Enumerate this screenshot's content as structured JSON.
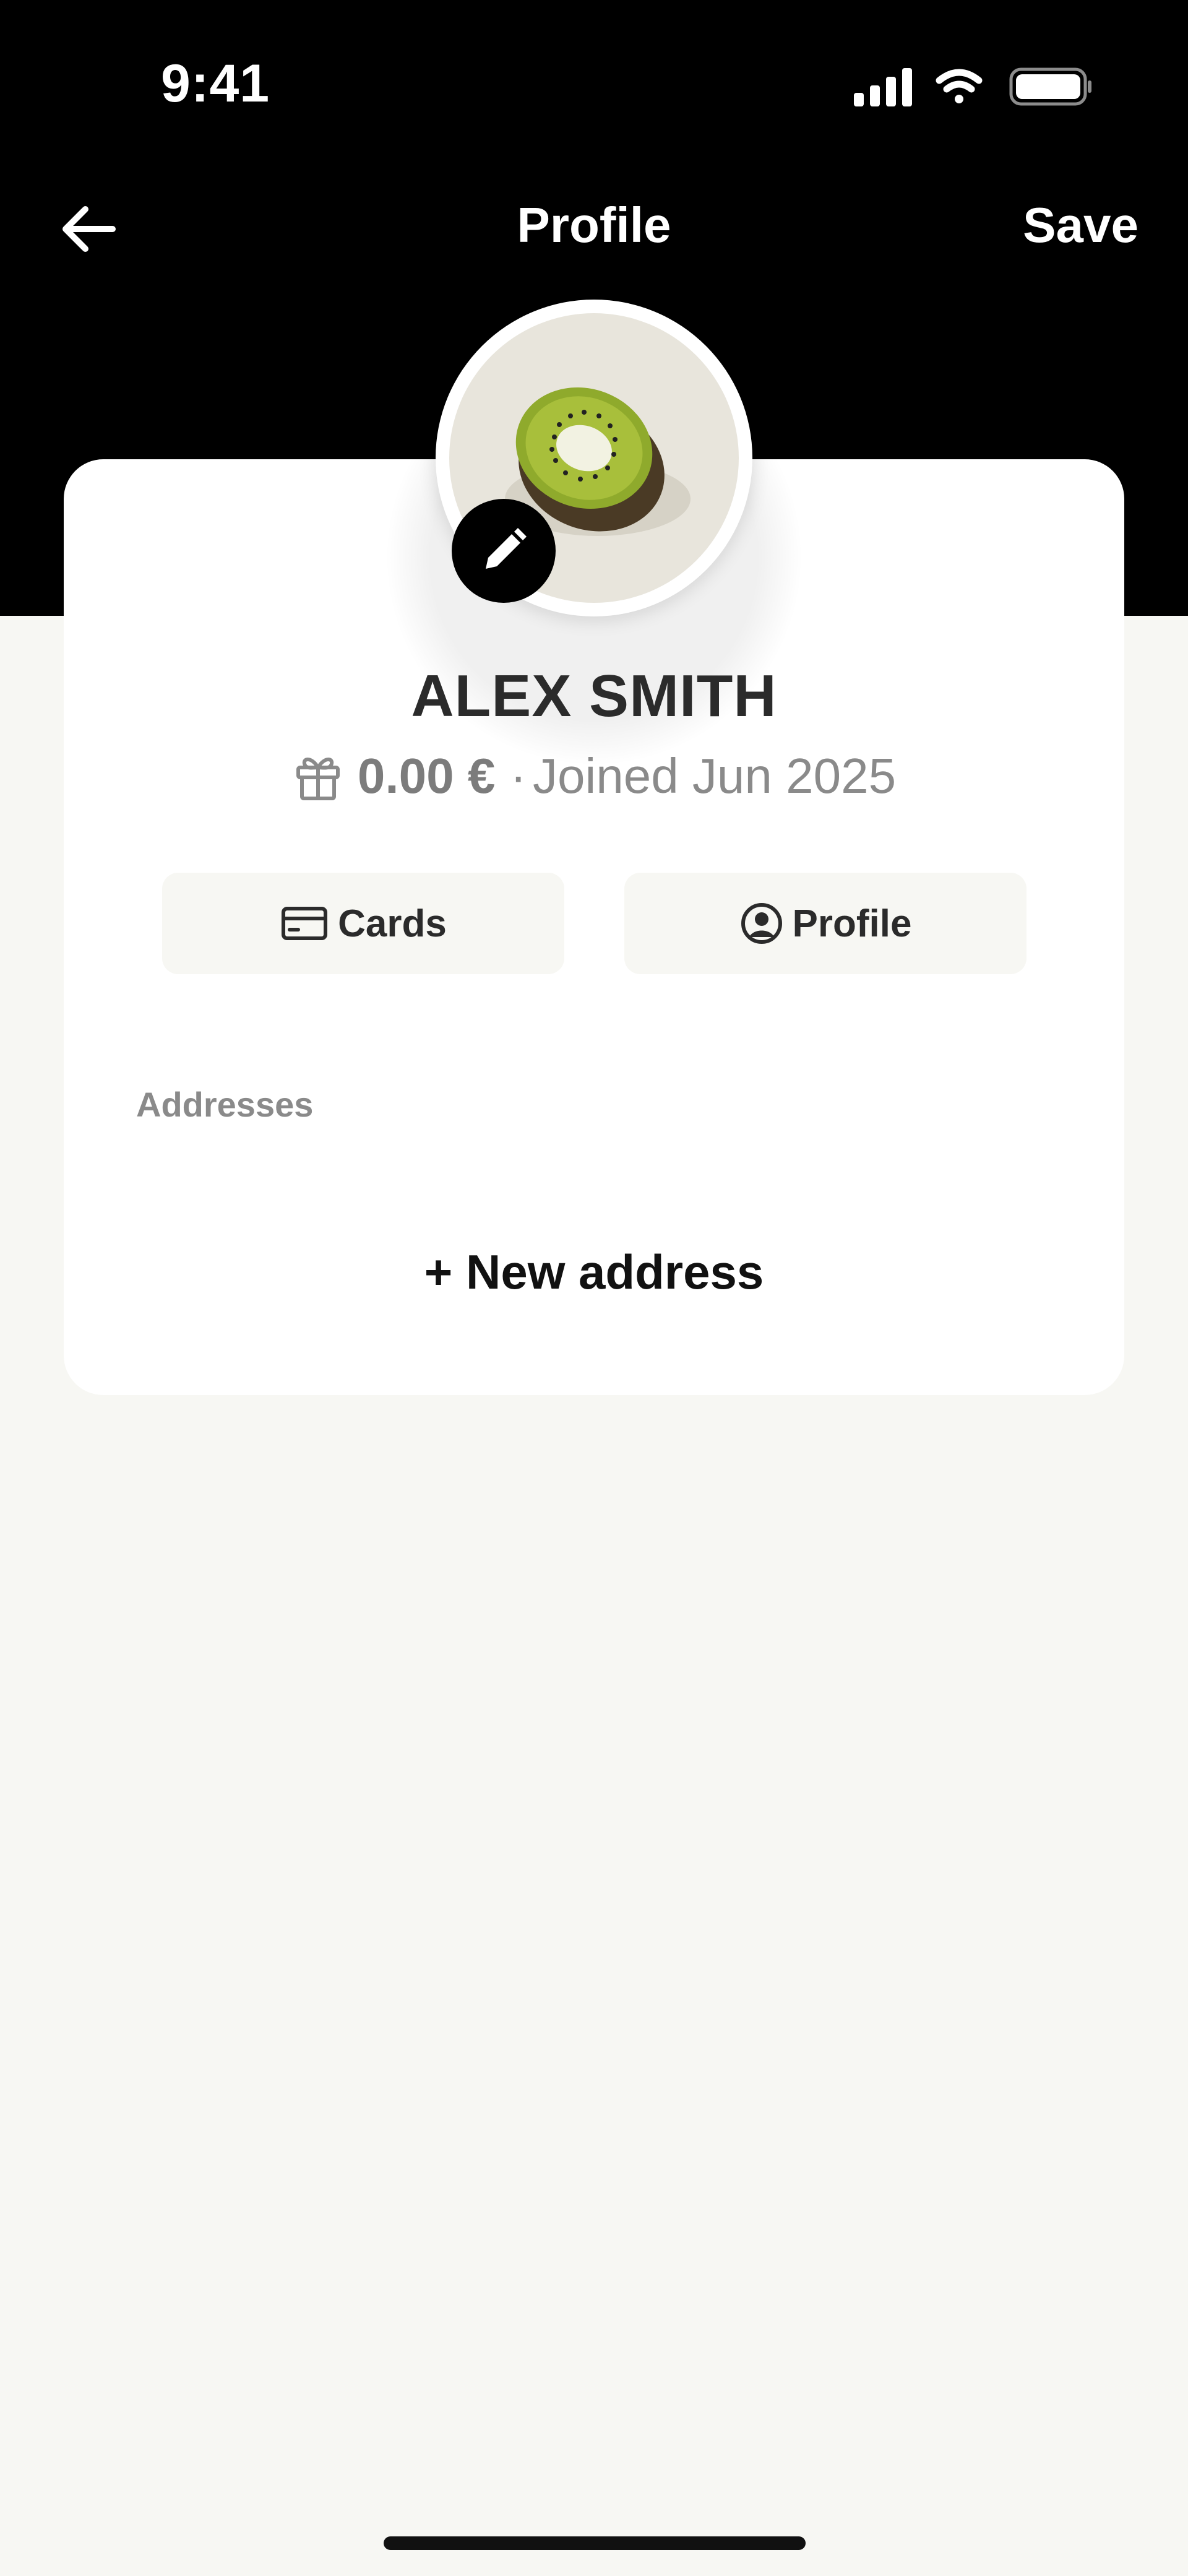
{
  "status_bar": {
    "time": "9:41",
    "icons": [
      "signal-icon",
      "wifi-icon",
      "battery-icon"
    ]
  },
  "nav": {
    "back_icon": "arrow-left-icon",
    "title": "Profile",
    "save_label": "Save"
  },
  "profile": {
    "avatar_icon": "kiwi-avatar",
    "edit_icon": "pencil-icon",
    "name": "ALEX SMITH",
    "gift_icon": "gift-icon",
    "balance": "0.00 €",
    "separator": "·",
    "joined": "Joined Jun 2025"
  },
  "actions": {
    "cards_label": "Cards",
    "cards_icon": "card-icon",
    "profile_label": "Profile",
    "profile_icon": "user-circle-icon"
  },
  "addresses": {
    "section_label": "Addresses",
    "new_address_label": "+ New address"
  },
  "colors": {
    "header_bg": "#000000",
    "page_bg": "#f7f7f3",
    "card_bg": "#ffffff",
    "pill_bg": "#f7f7f3",
    "text_dark": "#2b2b2b",
    "text_muted": "#8a8a8a"
  }
}
